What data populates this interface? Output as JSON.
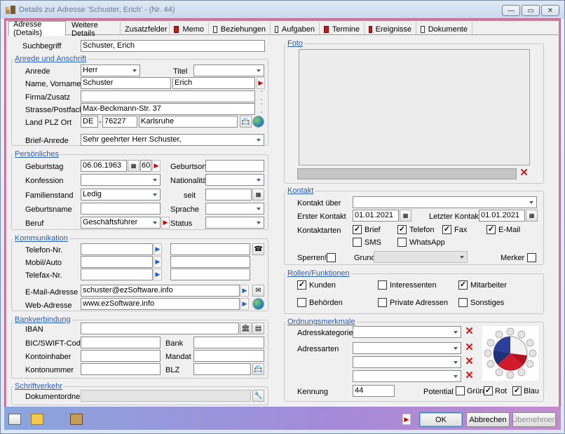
{
  "window": {
    "title": "Details zur Adresse 'Schuster, Erich' - (Nr. 44)",
    "min": "—",
    "max": "▭",
    "close": "✕"
  },
  "tabs": [
    {
      "label": "Adresse (Details)",
      "icon": "none"
    },
    {
      "label": "Weitere Details",
      "icon": "none"
    },
    {
      "label": "Zusatzfelder",
      "icon": "none"
    },
    {
      "label": "Memo",
      "icon": "red-doc-icon"
    },
    {
      "label": "Beziehungen",
      "icon": "doc-icon"
    },
    {
      "label": "Aufgaben",
      "icon": "doc-icon"
    },
    {
      "label": "Termine",
      "icon": "red-doc-icon"
    },
    {
      "label": "Ereignisse",
      "icon": "red-doc-icon"
    },
    {
      "label": "Dokumente",
      "icon": "doc-icon"
    }
  ],
  "suchbegriff": {
    "label": "Suchbegriff",
    "value": "Schuster, Erich"
  },
  "anrede": {
    "legend": "Anrede und Anschrift",
    "anrede_label": "Anrede",
    "anrede_value": "Herr",
    "titel_label": "Titel",
    "titel_value": "",
    "name_label": "Name, Vorname",
    "name_value": "Schuster",
    "vorname_value": "Erich",
    "firma_label": "Firma/Zusatz",
    "firma_value": "",
    "strasse_label": "Strasse/Postfach",
    "strasse_value": "Max-Beckmann-Str. 37",
    "land_label": "Land PLZ Ort",
    "land_value": "DE",
    "plz_value": "76227",
    "ort_value": "Karlsruhe",
    "dash": "-",
    "brief_label": "Brief-Anrede",
    "brief_value": "Sehr geehrter Herr Schuster,"
  },
  "persoenliches": {
    "legend": "Persönliches",
    "geburtstag_label": "Geburtstag",
    "geburtstag_value": "06.06.1963",
    "alter_value": "60",
    "geburtsort_label": "Geburtsort",
    "geburtsort_value": "",
    "konfession_label": "Konfession",
    "konfession_value": "",
    "nationalitaet_label": "Nationalität",
    "nationalitaet_value": "",
    "familienstand_label": "Familienstand",
    "familienstand_value": "Ledig",
    "seit_label": "seit",
    "seit_value": "",
    "geburtsname_label": "Geburtsname",
    "geburtsname_value": "",
    "sprache_label": "Sprache",
    "sprache_value": "",
    "beruf_label": "Beruf",
    "beruf_value": "Geschäftsführer",
    "status_label": "Status",
    "status_value": ""
  },
  "kommunikation": {
    "legend": "Kommunikation",
    "telefon_label": "Telefon-Nr.",
    "mobil_label": "Mobil/Auto",
    "telefax_label": "Telefax-Nr.",
    "email_label": "E-Mail-Adresse",
    "email_value": "schuster@ezSoftware.info",
    "web_label": "Web-Adresse",
    "web_value": "www.ezSoftware.info"
  },
  "bank": {
    "legend": "Bankverbindung",
    "iban_label": "IBAN",
    "bic_label": "BIC/SWIFT-Code",
    "bank_label": "Bank",
    "kontoinhaber_label": "Kontoinhaber",
    "mandat_label": "Mandat",
    "kontonummer_label": "Kontonummer",
    "blz_label": "BLZ"
  },
  "schrift": {
    "legend": "Schriftverkehr",
    "ordner_label": "Dokumentordner",
    "ordner_value": ""
  },
  "foto": {
    "legend": "Foto"
  },
  "kontakt": {
    "legend": "Kontakt",
    "ueber_label": "Kontakt über",
    "ueber_value": "",
    "erster_label": "Erster Kontakt",
    "erster_value": "01.01.2021",
    "letzter_label": "Letzter Kontakt",
    "letzter_value": "01.01.2021",
    "arten_label": "Kontaktarten",
    "brief": "Brief",
    "telefon": "Telefon",
    "fax": "Fax",
    "email": "E-Mail",
    "sms": "SMS",
    "whatsapp": "WhatsApp",
    "sperren_label": "Sperren!",
    "grund_label": "Grund",
    "grund_value": "",
    "merker_label": "Merker",
    "checks": {
      "brief": true,
      "telefon": true,
      "fax": true,
      "email": true,
      "sms": false,
      "whatsapp": false,
      "sperren": false,
      "merker": false
    }
  },
  "rollen": {
    "legend": "Rollen/Funktionen",
    "kunden": "Kunden",
    "interessenten": "Interessenten",
    "mitarbeiter": "Mitarbeiter",
    "behoerden": "Behörden",
    "private": "Private Adressen",
    "sonstiges": "Sonstiges",
    "checks": {
      "kunden": true,
      "interessenten": false,
      "mitarbeiter": true,
      "behoerden": false,
      "private": false,
      "sonstiges": false
    }
  },
  "ordnung": {
    "legend": "Ordnungsmerkmale",
    "kategorie_label": "Adresskategorie",
    "arten_label": "Adressarten",
    "kennung_label": "Kennung",
    "kennung_value": "44",
    "potential_label": "Potential",
    "gruen": "Grün",
    "rot": "Rot",
    "blau": "Blau",
    "checks": {
      "gruen": false,
      "rot": true,
      "blau": true
    }
  },
  "footer": {
    "ok": "OK",
    "abbrechen": "Abbrechen",
    "uebernehmen": "Übernehmen"
  },
  "colors": {
    "accent": "#2a5db0",
    "frame": "#d87a9f",
    "delete": "#d01a1a"
  }
}
